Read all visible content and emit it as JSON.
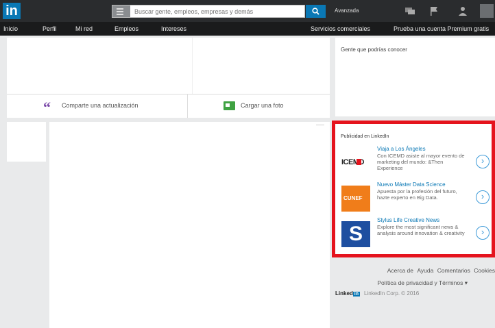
{
  "topbar": {
    "logo": "in",
    "search_placeholder": "Buscar gente, empleos, empresas y demás",
    "advanced": "Avanzada"
  },
  "nav": {
    "items": [
      "Inicio",
      "Perfil",
      "Mi red",
      "Empleos",
      "Intereses"
    ],
    "right": [
      "Servicios comerciales",
      "Prueba una cuenta Premium gratis"
    ]
  },
  "share": {
    "update_label": "Comparte una actualización",
    "photo_label": "Cargar una foto"
  },
  "people": {
    "title": "Gente que podrías conocer"
  },
  "ads": {
    "title": "Publicidad en LinkedIn",
    "items": [
      {
        "logo_text": "ICEMD",
        "title": "Viaja a Los Ángeles",
        "desc": "Con ICEMD asiste al mayor evento de marketing del mundo: &Then Experience"
      },
      {
        "logo_text": "CUNEF",
        "title": "Nuevo Máster Data Science",
        "desc": "Apuesta por la profesión del futuro, hazte experto en Big Data."
      },
      {
        "logo_text": "S",
        "title": "Stylus Life Creative News",
        "desc": "Explore the most significant news & analysis around innovation & creativity"
      }
    ]
  },
  "footer": {
    "row1": [
      "Acerca de",
      "Ayuda",
      "Comentarios",
      "Cookies"
    ],
    "row2": "Política de privacidad y Términos ▾",
    "brand": "Linked",
    "brand_box": "in",
    "copyright": "LinkedIn Corp. © 2016"
  },
  "colors": {
    "brand_blue": "#0a78b5",
    "ads_border": "#e5131d",
    "topbar": "#2a2c2e"
  }
}
